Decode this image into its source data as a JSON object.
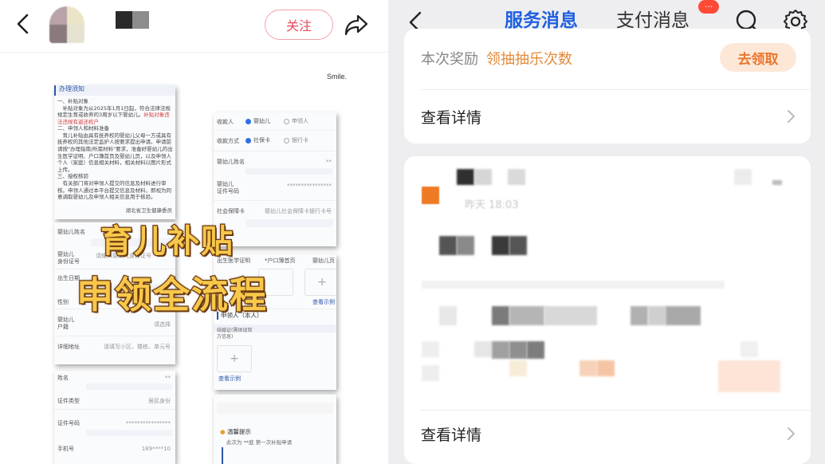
{
  "left": {
    "follow_label": "关注",
    "smile_text": "Smile.",
    "doc1": {
      "header": "办理须知",
      "body": "一、补贴对象\n　补贴对象为从2025年1月1日起，符合法律法规规定生育或收养的3周岁以下婴幼儿。",
      "body_red": "补贴对象违法违规有返还权户",
      "body2": "二、申领人和材料准备\n　育儿补贴由具有抚养权的婴幼儿父母一方或具有抚养权的其他法定监护人按要求提出申请。申请前请按\"办理指南/所需材料\"要求，准备好婴幼儿的出生医学证明、户口簿首页及婴幼儿页，以及申领人个人（家庭）信息相关材料，相关材料以图片形式上传。\n三、授权核验\n　有关部门将对申领人提交的信息及材料进行审核。申领人通过本平台提交信息及材料，即视为同意调取婴幼儿及申领人相关信息用于核验。",
      "sign": "湖北省卫生健康委员"
    },
    "doc2": {
      "payee_label": "收款人",
      "payee_opt1": "婴幼儿",
      "payee_opt2": "申领人",
      "method_label": "收款方式",
      "method_opt1": "社保卡",
      "method_opt2": "银行卡",
      "name_label": "婴幼儿姓名",
      "name_value": "**",
      "id_label": "婴幼儿\n证件号码",
      "id_value": "****************",
      "ss_label": "社会保障卡",
      "ss_value": "婴幼儿社会保障卡银行卡号"
    },
    "doc3": {
      "rows": [
        {
          "label": "婴幼儿姓名",
          "value": ""
        },
        {
          "label": "婴幼儿\n身份证号",
          "value": "请输入婴幼儿身份证号"
        },
        {
          "label": "出生日期",
          "value": ""
        },
        {
          "label": "性别",
          "value": ""
        },
        {
          "label": "婴幼儿\n户籍",
          "value": "请选择"
        },
        {
          "label": "详细地址",
          "value": "请填写小区、楼栋、单元号"
        }
      ]
    },
    "doc4": {
      "col1": "出生医学证明",
      "col2": "*户口簿首页",
      "col3": "婴幼儿页",
      "example": "查看示例",
      "section": "申领人（本人）",
      "upload_label": "结婚证(需体现双方信息)",
      "example2": "查看示例"
    },
    "doc5": {
      "rows": [
        {
          "label": "姓名",
          "value": "**"
        },
        {
          "label": "证件类型",
          "value": "居民身份"
        },
        {
          "label": "证件号码",
          "value": "****************"
        },
        {
          "label": "手机号",
          "value": "189****10"
        }
      ]
    },
    "doc6": {
      "tip_title": "温馨提示",
      "tip_text": "此次为 **庭 第一次补贴申请"
    },
    "overlay_line1": "育儿补贴",
    "overlay_line2": "申领全流程"
  },
  "right": {
    "tabs": [
      {
        "label": "服务消息",
        "active": true
      },
      {
        "label": "支付消息",
        "active": false
      }
    ],
    "pay_badge": "···",
    "card1": {
      "reward_label": "本次奖励",
      "reward_value": "领抽抽乐次数",
      "claim_button": "去领取",
      "detail_label": "查看详情"
    },
    "card2": {
      "time_text": "昨天 18:03",
      "detail_label": "查看详情"
    }
  },
  "colors": {
    "accent_blue": "#1f5fe0",
    "follow_red": "#e84a5f",
    "reward_orange": "#e38a38",
    "badge_red": "#ff4a36",
    "overlay_yellow": "#f7c84a"
  }
}
